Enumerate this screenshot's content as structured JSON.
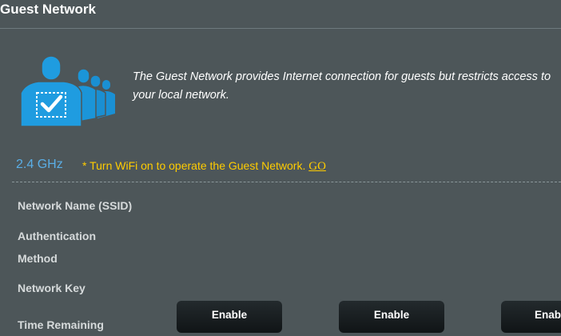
{
  "header": {
    "title": "Guest Network"
  },
  "intro": {
    "icon": "guest-users-check-icon",
    "line1": "The Guest Network provides Internet connection for guests but restricts access to",
    "line2": "your local network."
  },
  "band": {
    "label": "2.4 GHz",
    "notice": "* Turn WiFi on to operate the Guest Network.",
    "link": "GO"
  },
  "rows": {
    "ssid": "Network Name (SSID)",
    "auth_line1": "Authentication",
    "auth_line2": "Method",
    "key": "Network Key",
    "time": "Time Remaining"
  },
  "buttons": [
    "Enable",
    "Enable",
    "Enable"
  ],
  "colors": {
    "background": "#4d5659",
    "band_label": "#5aaee6",
    "notice": "#ffcc00",
    "icon_blue": "#1f9ce0"
  }
}
